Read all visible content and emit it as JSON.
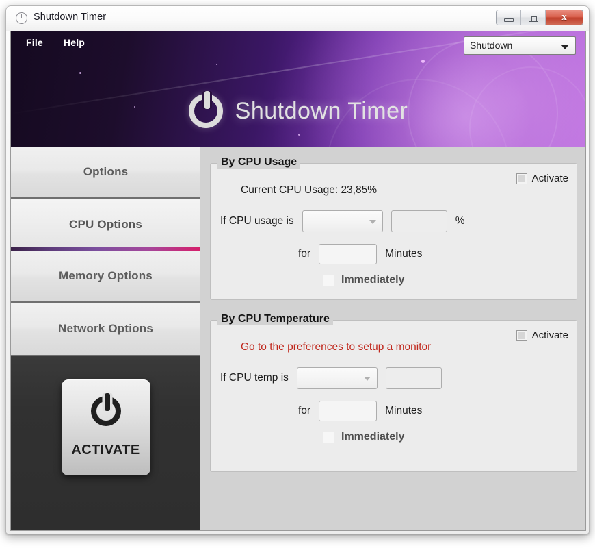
{
  "window": {
    "title": "Shutdown Timer",
    "icon": "clock-icon",
    "controls": {
      "minimize": "–",
      "maximize": "□",
      "close": "x"
    }
  },
  "menubar": {
    "items": [
      {
        "label": "File"
      },
      {
        "label": "Help"
      }
    ]
  },
  "mode_select": {
    "value": "Shutdown",
    "arrow": "chevron-down-icon"
  },
  "banner": {
    "brand_title": "Shutdown Timer",
    "brand_icon": "power-icon",
    "accent_dark": "#150a20",
    "accent_light": "#b768dd"
  },
  "sidebar": {
    "tabs": [
      {
        "label": "Options",
        "active": false
      },
      {
        "label": "CPU Options",
        "active": true
      },
      {
        "label": "Memory Options",
        "active": false
      },
      {
        "label": "Network Options",
        "active": false
      }
    ],
    "active_underline_from": "#3a2148",
    "active_underline_to": "#d61f6b",
    "activate_button": {
      "label": "ACTIVATE",
      "icon": "power-icon"
    }
  },
  "panels": {
    "cpu_usage": {
      "title": "By CPU Usage",
      "activate_label": "Activate",
      "activate_checked": false,
      "status": "Current CPU Usage: 23,85%",
      "condition_label": "If CPU usage is",
      "condition_value": "",
      "threshold_value": "",
      "unit": "%",
      "duration_label": "for",
      "duration_value": "",
      "duration_unit": "Minutes",
      "immediately_label": "Immediately",
      "immediately_checked": false
    },
    "cpu_temp": {
      "title": "By CPU Temperature",
      "activate_label": "Activate",
      "activate_checked": false,
      "warning": "Go to the preferences to setup a monitor",
      "warning_color": "#c0271c",
      "condition_label": "If CPU temp is",
      "condition_value": "",
      "threshold_value": "",
      "duration_label": "for",
      "duration_value": "",
      "duration_unit": "Minutes",
      "immediately_label": "Immediately",
      "immediately_checked": false
    }
  }
}
